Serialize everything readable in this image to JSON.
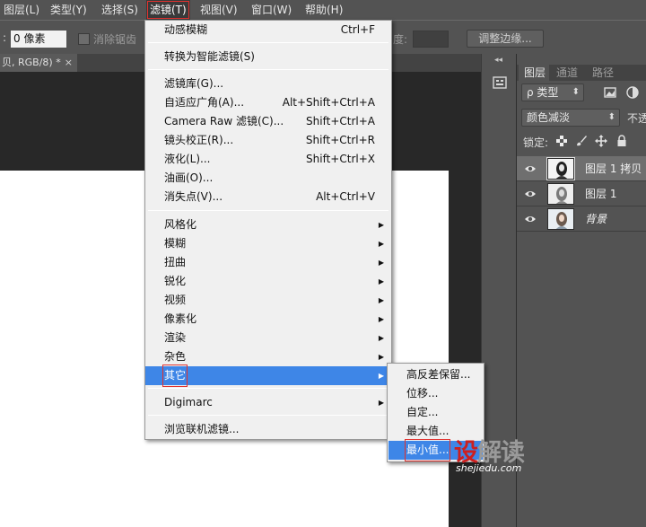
{
  "menubar": {
    "items": [
      "图层(L)",
      "类型(Y)",
      "选择(S)",
      "滤镜(T)",
      "视图(V)",
      "窗口(W)",
      "帮助(H)"
    ],
    "active_index": 3
  },
  "options_bar": {
    "lead": ":",
    "feather_value": "0 像素",
    "antialias_label": "消除锯齿",
    "density_label": "度:",
    "refine_edge_button": "调整边缘..."
  },
  "document": {
    "tab_title": "贝, RGB/8) *",
    "tab_close": "×"
  },
  "filter_menu": {
    "items": [
      {
        "label": "动感模糊",
        "shortcut": "Ctrl+F"
      },
      {
        "label": "转换为智能滤镜(S)",
        "shortcut": ""
      },
      {
        "label": "滤镜库(G)...",
        "shortcut": ""
      },
      {
        "label": "自适应广角(A)...",
        "shortcut": "Alt+Shift+Ctrl+A"
      },
      {
        "label": "Camera Raw 滤镜(C)...",
        "shortcut": "Shift+Ctrl+A"
      },
      {
        "label": "镜头校正(R)...",
        "shortcut": "Shift+Ctrl+R"
      },
      {
        "label": "液化(L)...",
        "shortcut": "Shift+Ctrl+X"
      },
      {
        "label": "油画(O)...",
        "shortcut": ""
      },
      {
        "label": "消失点(V)...",
        "shortcut": "Alt+Ctrl+V"
      },
      {
        "label": "风格化",
        "shortcut": ""
      },
      {
        "label": "模糊",
        "shortcut": ""
      },
      {
        "label": "扭曲",
        "shortcut": ""
      },
      {
        "label": "锐化",
        "shortcut": ""
      },
      {
        "label": "视频",
        "shortcut": ""
      },
      {
        "label": "像素化",
        "shortcut": ""
      },
      {
        "label": "渲染",
        "shortcut": ""
      },
      {
        "label": "杂色",
        "shortcut": ""
      },
      {
        "label": "其它",
        "shortcut": ""
      },
      {
        "label": "Digimarc",
        "shortcut": ""
      },
      {
        "label": "浏览联机滤镜...",
        "shortcut": ""
      }
    ],
    "submenu_arrow": "▶",
    "hover_index": 17
  },
  "other_submenu": {
    "items": [
      "高反差保留...",
      "位移...",
      "自定...",
      "最大值...",
      "最小值..."
    ],
    "hover_index": 4
  },
  "right_strip": {
    "collapse_glyph": "◂◂"
  },
  "layers_panel": {
    "tabs": [
      "图层",
      "通道",
      "路径"
    ],
    "active_tab": 0,
    "filter_kind": "ρ 类型",
    "blend_mode": "颜色减淡",
    "opacity_label": "不透",
    "lock_label": "锁定:",
    "dropdown_arrow": "⬍",
    "layers": [
      {
        "name": "图层 1 拷贝",
        "selected": true,
        "italic": false
      },
      {
        "name": "图层 1",
        "selected": false,
        "italic": false
      },
      {
        "name": "背景",
        "selected": false,
        "italic": true
      }
    ]
  },
  "watermark": {
    "brand_first": "设",
    "brand_rest": "解读",
    "domain": "shejiedu.com"
  }
}
